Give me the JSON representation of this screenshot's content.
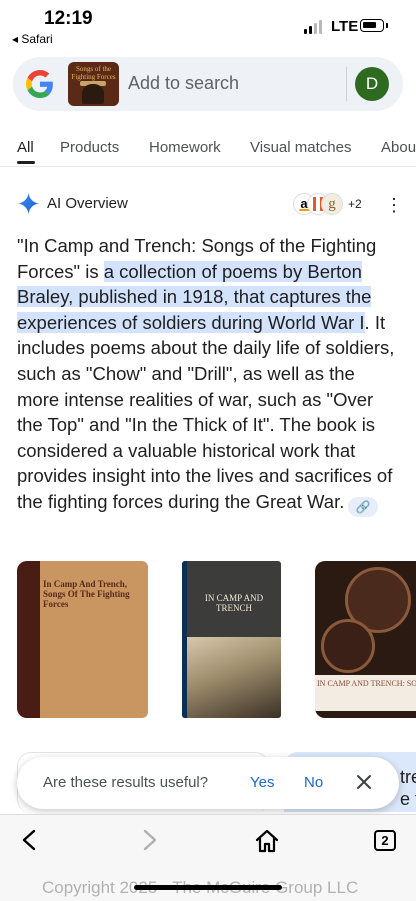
{
  "status_bar": {
    "time": "12:19",
    "back_app": "◂ Safari",
    "network": "LTE"
  },
  "search": {
    "placeholder": "Add to search",
    "avatar_letter": "D",
    "thumbnail_title": "Songs of the Fighting Forces"
  },
  "tabs": [
    {
      "label": "All",
      "active": true
    },
    {
      "label": "Products"
    },
    {
      "label": "Homework"
    },
    {
      "label": "Visual matches"
    },
    {
      "label": "Abou"
    }
  ],
  "ai_overview": {
    "title": "AI Overview",
    "source_count": "+2",
    "text_before": "\"In Camp and Trench: Songs of the Fighting Forces\" is ",
    "text_highlight": "a collection of poems by Berton Braley, published in 1918, that captures the experiences of soldiers during World War I",
    "text_after": ". It includes poems about the daily life of soldiers, such as \"Chow\" and \"Drill\", as well as the more intense realities of war, such as \"Over the Top\" and \"In the Thick of It\". The book is considered a valuable historical work that provides insight into the lives and sacrifices of the fighting forces during the Great War."
  },
  "images": [
    {
      "title": "In Camp And Trench, Songs Of The Fighting Forces"
    },
    {
      "title": "IN CAMP AND TRENCH"
    },
    {
      "title": "IN CAMP AND TRENCH: SONGS OF THE FIGHTING FOR"
    }
  ],
  "right_card_text": "tre\ne fig",
  "feedback": {
    "question": "Are these results useful?",
    "yes": "Yes",
    "no": "No"
  },
  "toolbar": {
    "tab_count": "2"
  },
  "watermark": "Copyright 2025 - The McGuire Group LLC",
  "colors": {
    "highlight": "#d3e3fd",
    "link_blue": "#1a66d2",
    "avatar_green": "#2e6b21"
  }
}
